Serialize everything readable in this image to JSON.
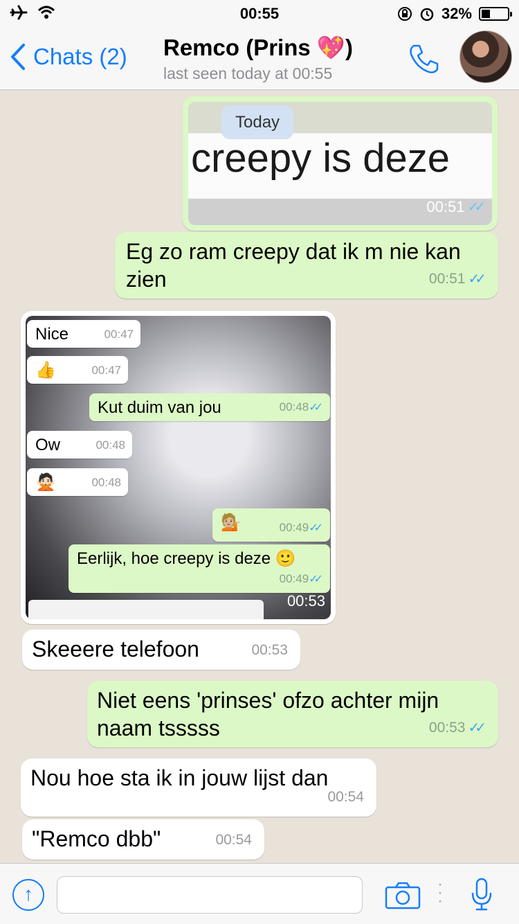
{
  "status_bar": {
    "time": "00:55",
    "battery": "32%",
    "battery_level": 0.32
  },
  "nav": {
    "back_label": "Chats (2)",
    "contact_name": "Remco (Prins 💖)",
    "last_seen": "last seen today at 00:55"
  },
  "messages": {
    "img1": {
      "badge": "Today",
      "text": "creepy is deze",
      "time": "00:51"
    },
    "m1": {
      "text": "Eg zo ram creepy dat ik m nie kan zien",
      "time": "00:51"
    },
    "img2": {
      "time": "00:53",
      "items": [
        {
          "text": "Nice",
          "time": "00:47"
        },
        {
          "text": "👍",
          "time": "00:47"
        },
        {
          "text": "Kut duim van jou",
          "time": "00:48"
        },
        {
          "text": "Ow",
          "time": "00:48"
        },
        {
          "text": "🙅🏻",
          "time": "00:48"
        },
        {
          "text": "💁🏼",
          "time": "00:49"
        },
        {
          "text": "Eerlijk, hoe creepy is deze 🙂",
          "time": "00:49"
        }
      ]
    },
    "m2": {
      "text": "Skeeere telefoon",
      "time": "00:53"
    },
    "m3": {
      "text": "Niet eens 'prinses' ofzo achter mijn naam tsssss",
      "time": "00:53"
    },
    "m4": {
      "text": "Nou hoe sta ik in jouw lijst dan",
      "time": "00:54"
    },
    "m5": {
      "text": "\"Remco dbb\"",
      "time": "00:54"
    }
  },
  "colors": {
    "outgoing": "#dcf8c6",
    "incoming": "#ffffff",
    "accent": "#147efb",
    "read_ticks": "#38a7f0"
  }
}
